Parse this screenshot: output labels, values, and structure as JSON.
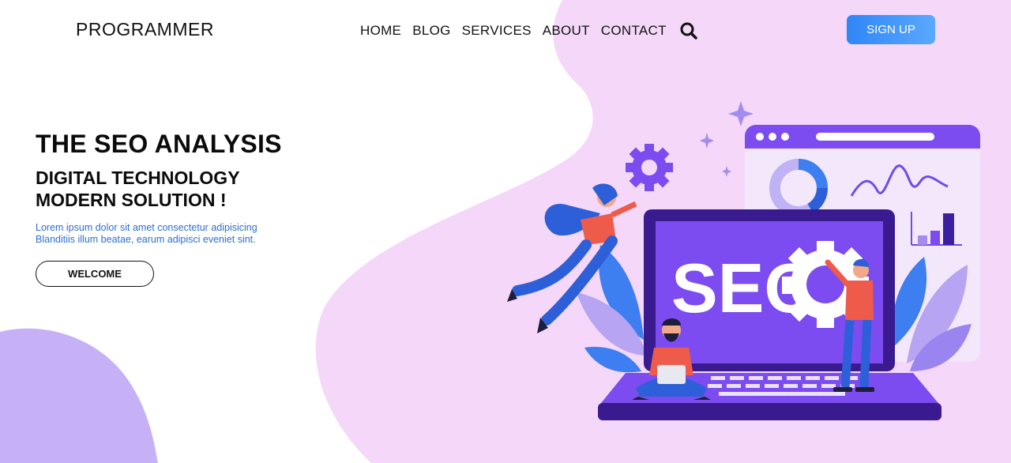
{
  "brand": {
    "logo_text": "PROGRAMMER"
  },
  "nav": {
    "items": [
      {
        "label": "HOME"
      },
      {
        "label": "BLOG"
      },
      {
        "label": "SERVICES"
      },
      {
        "label": "ABOUT"
      },
      {
        "label": "CONTACT"
      }
    ],
    "search_icon": "search-icon",
    "signup_label": "SIGN UP"
  },
  "hero": {
    "title": "THE SEO ANALYSIS",
    "subtitle_line1": "DIGITAL TECHNOLOGY",
    "subtitle_line2": "MODERN SOLUTION !",
    "text_line1": "Lorem ipsum dolor sit amet consectetur adipisicing",
    "text_line2": "Blanditiis illum beatae, earum adipisci eveniet sint.",
    "button_label": "WELCOME"
  },
  "illustration": {
    "screen_text": "SEO"
  },
  "colors": {
    "blob_pink": "#f5d7f9",
    "blob_purple": "#c6b1f6",
    "accent_blue": "#2f86f6",
    "laptop_purple": "#7d4cf0"
  }
}
